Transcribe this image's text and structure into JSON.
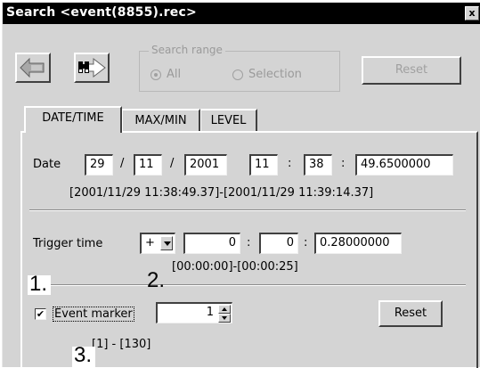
{
  "window": {
    "title": "Search <event(8855).rec>",
    "close_label": "x"
  },
  "toolbar": {
    "back_icon": "arrow-left-icon",
    "find_icon": "binoculars-arrow-icon",
    "search_range": {
      "legend": "Search range",
      "all_label": "All",
      "selection_label": "Selection",
      "selected": "All"
    },
    "reset_label": "Reset"
  },
  "tabs": [
    {
      "label": "DATE/TIME",
      "active": true
    },
    {
      "label": "MAX/MIN",
      "active": false
    },
    {
      "label": "LEVEL",
      "active": false
    }
  ],
  "date": {
    "label": "Date",
    "day": "29",
    "month": "11",
    "year": "2001",
    "hour": "11",
    "minute": "38",
    "second": "49.6500000",
    "sep_slash": "/",
    "sep_colon": ":",
    "range_text": "[2001/11/29 11:38:49.37]-[2001/11/29 11:39:14.37]"
  },
  "trigger": {
    "label": "Trigger time",
    "sign": "+",
    "hour": "0",
    "minute": "0",
    "second": "0.28000000",
    "sep_colon": ":",
    "range_text": "[00:00:00]-[00:00:25]"
  },
  "event_marker": {
    "checked": true,
    "check_glyph": "✔",
    "label": "Event marker",
    "value": "1",
    "range_text": "[1] - [130]",
    "reset_label": "Reset"
  },
  "annotations": {
    "one": "1.",
    "two": "2.",
    "three": "3."
  },
  "colors": {
    "titlebar": "#000000",
    "face": "#d4d4d4",
    "disabled_text": "#9a9a9a"
  }
}
